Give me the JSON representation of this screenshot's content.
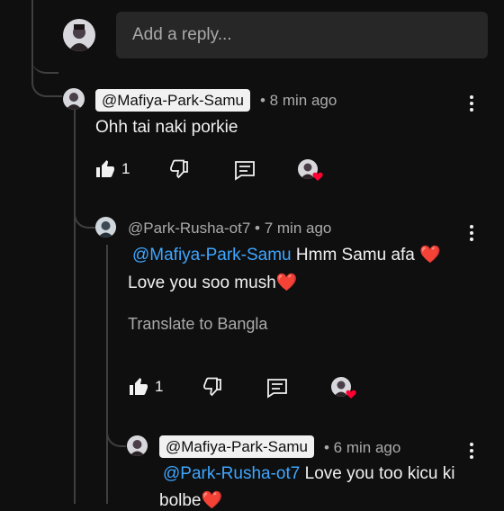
{
  "reply_box": {
    "placeholder": "Add a reply..."
  },
  "comments": [
    {
      "author": "@Mafiya-Park-Samu",
      "time": "• 8 min ago",
      "text": "Ohh tai naki porkie",
      "likes": "1"
    },
    {
      "author": "@Park-Rusha-ot7",
      "time": "• 7 min ago",
      "mention": "@Mafiya-Park-Samu",
      "text_line1_rest": "Hmm Samu afa ❤️",
      "text_line2": "Love you soo mush❤️",
      "translate": "Translate to Bangla",
      "likes": "1"
    },
    {
      "author": "@Mafiya-Park-Samu",
      "time": "• 6 min ago",
      "mention": "@Park-Rusha-ot7",
      "text_line1_rest": "Love you too kicu ki",
      "text_line2": "bolbe❤️"
    }
  ],
  "icons": {
    "like": "thumbs-up-icon",
    "dislike": "thumbs-down-icon",
    "reply": "comment-icon",
    "creator_heart": "creator-heart-icon",
    "more": "kebab-menu-icon"
  },
  "colors": {
    "background": "#0f0f0f",
    "mention": "#3ea6ff",
    "heart": "#ff0033"
  }
}
